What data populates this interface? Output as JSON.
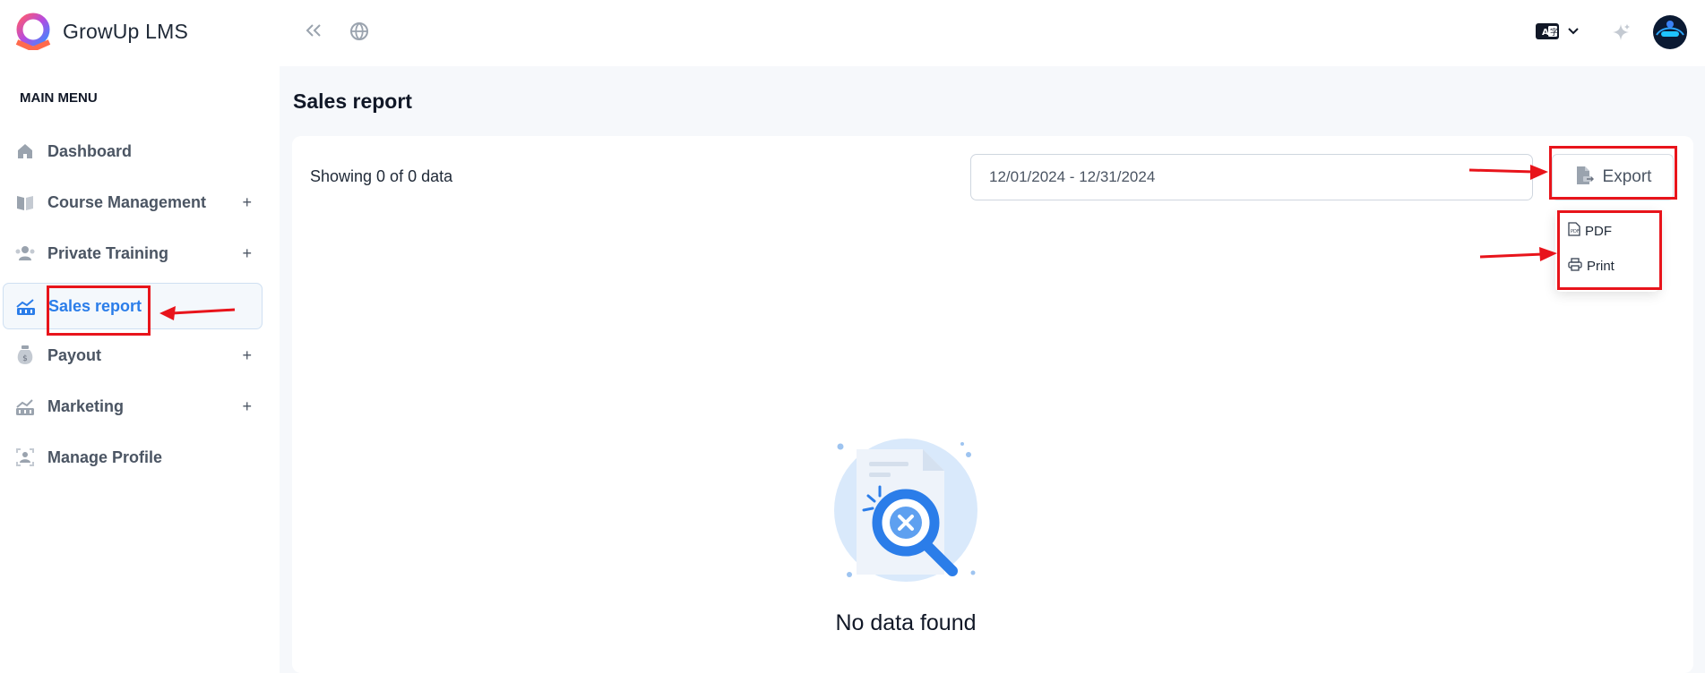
{
  "app": {
    "name": "GrowUp LMS"
  },
  "sidebar": {
    "heading": "MAIN MENU",
    "items": [
      {
        "label": "Dashboard",
        "icon": "home-icon",
        "expandable": false,
        "active": false
      },
      {
        "label": "Course Management",
        "icon": "book-icon",
        "expandable": true,
        "active": false
      },
      {
        "label": "Private Training",
        "icon": "users-icon",
        "expandable": true,
        "active": false
      },
      {
        "label": "Sales report",
        "icon": "chart-icon",
        "expandable": false,
        "active": true
      },
      {
        "label": "Payout",
        "icon": "money-bag-icon",
        "expandable": true,
        "active": false
      },
      {
        "label": "Marketing",
        "icon": "megaphone-icon",
        "expandable": true,
        "active": false
      },
      {
        "label": "Manage Profile",
        "icon": "profile-icon",
        "expandable": false,
        "active": false
      }
    ],
    "plus_symbol": "+"
  },
  "topbar": {
    "icons": [
      "collapse-sidebar-icon",
      "globe-icon",
      "language-icon",
      "chevron-down-icon",
      "sparkle-icon",
      "avatar"
    ]
  },
  "page": {
    "title": "Sales report"
  },
  "report": {
    "showing_text": "Showing 0 of 0 data",
    "date_range": "12/01/2024 - 12/31/2024",
    "export_label": "Export",
    "export_menu": [
      {
        "label": "PDF",
        "icon": "pdf-file-icon"
      },
      {
        "label": "Print",
        "icon": "printer-icon"
      }
    ],
    "empty_message": "No data found"
  },
  "colors": {
    "accent": "#2b7de9",
    "annotation": "#e8141b",
    "background": "#f6f8fb"
  }
}
